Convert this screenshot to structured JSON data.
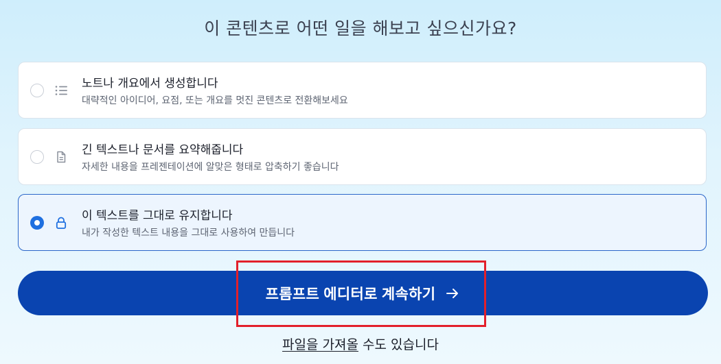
{
  "title": "이 콘텐츠로 어떤 일을 해보고 싶으신가요?",
  "options": [
    {
      "title": "노트나 개요에서 생성합니다",
      "subtitle": "대략적인 아이디어, 요점, 또는 개요를 멋진 콘텐츠로 전환해보세요",
      "icon": "list-icon",
      "selected": false
    },
    {
      "title": "긴 텍스트나 문서를 요약해줍니다",
      "subtitle": "자세한 내용을 프레젠테이션에 알맞은 형태로 압축하기 좋습니다",
      "icon": "document-icon",
      "selected": false
    },
    {
      "title": "이 텍스트를 그대로 유지합니다",
      "subtitle": "내가 작성한 텍스트 내용을 그대로 사용하여 만듭니다",
      "icon": "lock-icon",
      "selected": true
    }
  ],
  "cta": {
    "label": "프롬프트 에디터로 계속하기",
    "icon": "arrow-right-icon"
  },
  "footer": {
    "link_text": "파일을 가져올",
    "rest_text": " 수도 있습니다"
  },
  "colors": {
    "accent": "#0a44b0",
    "radio_selected": "#1e6fe0",
    "highlight": "#e2202b",
    "selected_bg": "#edf5fe"
  }
}
